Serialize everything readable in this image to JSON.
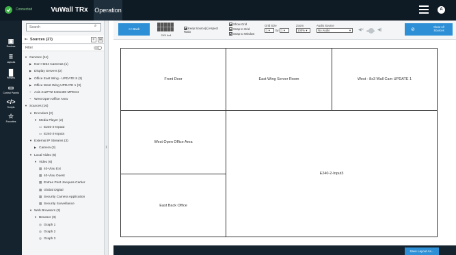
{
  "topbar": {
    "status": "Connected",
    "app_title": "VuWall TRx",
    "tab": "Operation",
    "user_initial": "A",
    "colors": {
      "bar": "#0e1a24",
      "status": "#3cb043",
      "accent": "#2d8fd5"
    }
  },
  "rail": {
    "items": [
      {
        "label": "Devices",
        "icon": "monitor-icon"
      },
      {
        "label": "Layouts",
        "icon": "grid-icon"
      },
      {
        "label": "Presets",
        "icon": "bars-icon"
      },
      {
        "label": "Control Panels",
        "icon": "panel-icon"
      },
      {
        "label": "Scripts",
        "icon": "code-icon"
      },
      {
        "label": "Favorites",
        "icon": "star-icon"
      }
    ]
  },
  "panel": {
    "search_placeholder": "Search",
    "sources_title": "Sources (27)",
    "filter_label": "Filter",
    "tree": [
      {
        "level": 0,
        "arrow": "down",
        "label": "Genetec (11)"
      },
      {
        "level": 1,
        "arrow": "right",
        "label": "Non-H264 Cameras (1)"
      },
      {
        "level": 1,
        "arrow": "right",
        "label": "Display Servers (2)"
      },
      {
        "level": 1,
        "arrow": "right",
        "label": "Office East Wing - UPDATE 8 (3)"
      },
      {
        "level": 1,
        "arrow": "right",
        "label": "Office West Wing UPDATE 1 (3)"
      },
      {
        "level": 1,
        "arrow": "none",
        "icon": "camera-icon",
        "label": "Axis 212PTZ 640x480 MPEG4"
      },
      {
        "level": 1,
        "arrow": "none",
        "icon": "camera-icon",
        "label": "West Open Office Area"
      },
      {
        "level": 0,
        "arrow": "down",
        "label": "Sources (16)"
      },
      {
        "level": 1,
        "arrow": "down",
        "label": "Encoders (2)"
      },
      {
        "level": 2,
        "arrow": "down",
        "label": "Media Player (2)"
      },
      {
        "level": 3,
        "arrow": "none",
        "icon": "encoder-icon",
        "label": "E240-2-Input3"
      },
      {
        "level": 3,
        "arrow": "none",
        "icon": "encoder-icon",
        "label": "E240-2-Input4"
      },
      {
        "level": 1,
        "arrow": "down",
        "label": "External IP Streams (3)"
      },
      {
        "level": 2,
        "arrow": "right",
        "label": "Camera (3)"
      },
      {
        "level": 1,
        "arrow": "down",
        "label": "Local Video (6)"
      },
      {
        "level": 2,
        "arrow": "down",
        "label": "Video (6)"
      },
      {
        "level": 3,
        "arrow": "none",
        "icon": "video-icon",
        "label": "40-Vlau Ext"
      },
      {
        "level": 3,
        "arrow": "none",
        "icon": "video-icon",
        "label": "40-Vlau Ouest"
      },
      {
        "level": 3,
        "arrow": "none",
        "icon": "video-icon",
        "label": "Entree Pont Jacques-Cartier"
      },
      {
        "level": 3,
        "arrow": "none",
        "icon": "video-icon",
        "label": "Global Digital"
      },
      {
        "level": 3,
        "arrow": "none",
        "icon": "video-icon",
        "label": "Security Camera Application"
      },
      {
        "level": 3,
        "arrow": "none",
        "icon": "video-icon",
        "label": "Security Surveillance"
      },
      {
        "level": 1,
        "arrow": "down",
        "label": "Web Browsers (3)"
      },
      {
        "level": 2,
        "arrow": "down",
        "label": "Browser (3)"
      },
      {
        "level": 3,
        "arrow": "none",
        "icon": "globe-icon",
        "label": "Graph 1"
      },
      {
        "level": 3,
        "arrow": "none",
        "icon": "globe-icon",
        "label": "Graph 2"
      },
      {
        "level": 3,
        "arrow": "none",
        "icon": "globe-icon",
        "label": "Graph 3"
      }
    ]
  },
  "toolbar": {
    "back_label": "<< Back",
    "layout_name": "2X5 4x4",
    "keep_aspect": "Keep Source(s) Aspect Ratio",
    "show_grid": "Show Grid",
    "snap_grid": "Snap to Grid",
    "snap_window": "Snap to Window",
    "grid_size_label": "Grid Size",
    "grid_x": "1",
    "grid_by": "by",
    "grid_y": "1",
    "zoom_label": "Zoom",
    "zoom_value": "100%",
    "audio_label": "Audio Source",
    "audio_value": "No Audio",
    "clear_label": "Clear All Sources"
  },
  "canvas": {
    "zones": [
      "Front Door",
      "East Wing Server Room",
      "West - 8x3 Wall Cam UPDATE 1",
      "West Open Office Area",
      "E240-2-Input3",
      "East Back Office"
    ]
  },
  "footer": {
    "save_label": "Save Layout As..."
  }
}
